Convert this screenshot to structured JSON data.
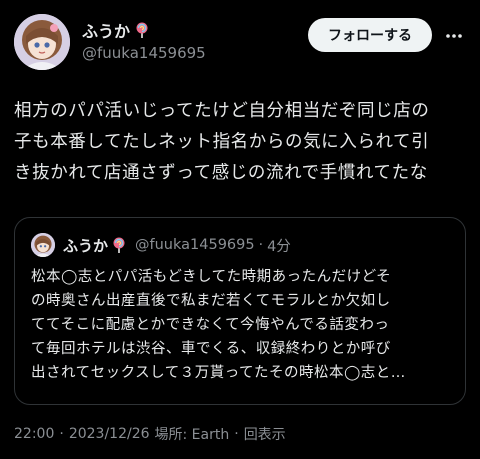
{
  "author": {
    "display_name": "ふうか",
    "handle": "@fuuka1459695",
    "name_emoji": "lollipop-icon"
  },
  "follow_button": {
    "label": "フォローする"
  },
  "more_menu": {
    "icon": "more-horizontal-icon"
  },
  "tweet": {
    "lines": [
      "相方のパパ活いじってたけど自分相当だぞ同じ店の",
      "子も本番してたしネット指名からの気に入られて引",
      "き抜かれて店通さずって感じの流れで手慣れてたな"
    ]
  },
  "quote": {
    "display_name": "ふうか",
    "handle": "@fuuka1459695",
    "separator": "·",
    "time": "4分",
    "lines": [
      "松本◯志とパパ活もどきしてた時期あったんだけどそ",
      "の時奥さん出産直後で私まだ若くてモラルとか欠如し",
      "ててそこに配慮とかできなくて今悔やんでる話変わっ",
      "て毎回ホテルは渋谷、車でくる、収録終わりとか呼び",
      "出されてセックスして３万貰ってたその時松本◯志と…"
    ]
  },
  "meta": {
    "time": "22:00",
    "sep1": "·",
    "date": "2023/12/26",
    "location": "場所: Earth",
    "sep2": "·",
    "views": "回表示"
  },
  "colors": {
    "background": "#000000",
    "text": "#e7e9ea",
    "muted": "#8b8f94",
    "border": "#2f3336",
    "button_bg": "#eff3f4"
  }
}
